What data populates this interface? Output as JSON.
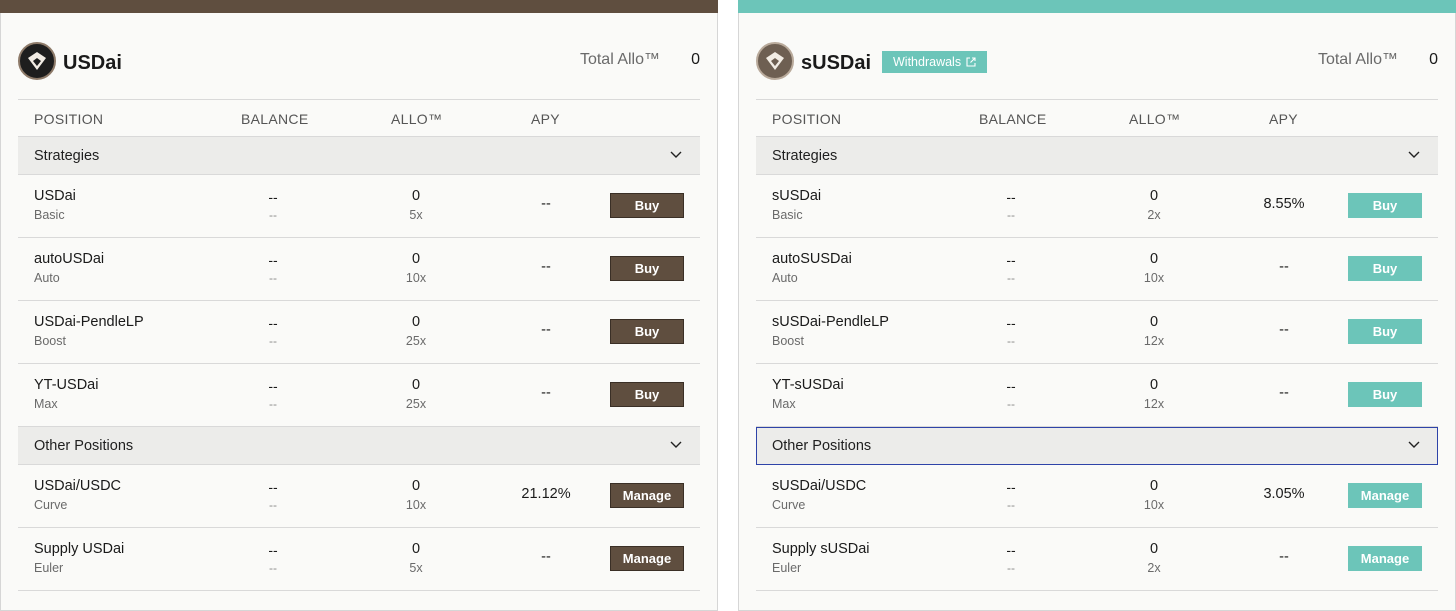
{
  "colors": {
    "usdai_accent": "#5f4e3f",
    "susdai_accent": "#6cc5b9",
    "focus_ring": "#2e43a8"
  },
  "panels": [
    {
      "title": "USDai",
      "badge": "",
      "total_allo_label": "Total Allo™",
      "total_allo_value": "0",
      "columns": [
        "POSITION",
        "BALANCE",
        "ALLO™",
        "APY"
      ],
      "strategies_label": "Strategies",
      "other_label": "Other Positions",
      "strategies": [
        {
          "name": "USDai",
          "sub": "Basic",
          "balance": "--",
          "balance_sub": "--",
          "allo": "0",
          "mult": "5x",
          "apy": "--",
          "action": "Buy"
        },
        {
          "name": "autoUSDai",
          "sub": "Auto",
          "balance": "--",
          "balance_sub": "--",
          "allo": "0",
          "mult": "10x",
          "apy": "--",
          "action": "Buy"
        },
        {
          "name": "USDai-PendleLP",
          "sub": "Boost",
          "balance": "--",
          "balance_sub": "--",
          "allo": "0",
          "mult": "25x",
          "apy": "--",
          "action": "Buy"
        },
        {
          "name": "YT-USDai",
          "sub": "Max",
          "balance": "--",
          "balance_sub": "--",
          "allo": "0",
          "mult": "25x",
          "apy": "--",
          "action": "Buy"
        }
      ],
      "others": [
        {
          "name": "USDai/USDC",
          "sub": "Curve",
          "balance": "--",
          "balance_sub": "--",
          "allo": "0",
          "mult": "10x",
          "apy": "21.12%",
          "action": "Manage"
        },
        {
          "name": "Supply USDai",
          "sub": "Euler",
          "balance": "--",
          "balance_sub": "--",
          "allo": "0",
          "mult": "5x",
          "apy": "--",
          "action": "Manage"
        }
      ]
    },
    {
      "title": "sUSDai",
      "badge": "Withdrawals",
      "total_allo_label": "Total Allo™",
      "total_allo_value": "0",
      "columns": [
        "POSITION",
        "BALANCE",
        "ALLO™",
        "APY"
      ],
      "strategies_label": "Strategies",
      "other_label": "Other Positions",
      "strategies": [
        {
          "name": "sUSDai",
          "sub": "Basic",
          "balance": "--",
          "balance_sub": "--",
          "allo": "0",
          "mult": "2x",
          "apy": "8.55%",
          "action": "Buy"
        },
        {
          "name": "autoSUSDai",
          "sub": "Auto",
          "balance": "--",
          "balance_sub": "--",
          "allo": "0",
          "mult": "10x",
          "apy": "--",
          "action": "Buy"
        },
        {
          "name": "sUSDai-PendleLP",
          "sub": "Boost",
          "balance": "--",
          "balance_sub": "--",
          "allo": "0",
          "mult": "12x",
          "apy": "--",
          "action": "Buy"
        },
        {
          "name": "YT-sUSDai",
          "sub": "Max",
          "balance": "--",
          "balance_sub": "--",
          "allo": "0",
          "mult": "12x",
          "apy": "--",
          "action": "Buy"
        }
      ],
      "others": [
        {
          "name": "sUSDai/USDC",
          "sub": "Curve",
          "balance": "--",
          "balance_sub": "--",
          "allo": "0",
          "mult": "10x",
          "apy": "3.05%",
          "action": "Manage"
        },
        {
          "name": "Supply sUSDai",
          "sub": "Euler",
          "balance": "--",
          "balance_sub": "--",
          "allo": "0",
          "mult": "2x",
          "apy": "--",
          "action": "Manage"
        }
      ]
    }
  ]
}
